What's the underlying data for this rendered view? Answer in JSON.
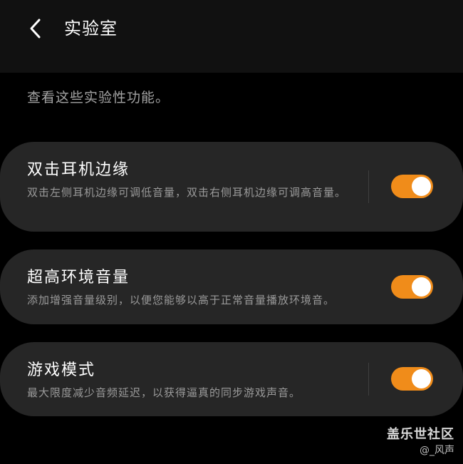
{
  "header": {
    "title": "实验室",
    "back_icon": "chevron-left-icon"
  },
  "description": "查看这些实验性功能。",
  "features": [
    {
      "title": "双击耳机边缘",
      "description": "双击左侧耳机边缘可调低音量，双击右侧耳机边缘可调高音量。",
      "enabled": true
    },
    {
      "title": "超高环境音量",
      "description": "添加增强音量级别，以便您能够以高于正常音量播放环境音。",
      "enabled": true
    },
    {
      "title": "游戏模式",
      "description": "最大限度减少音频延迟，以获得逼真的同步游戏声音。",
      "enabled": true
    }
  ],
  "colors": {
    "accent": "#f08c1a",
    "card": "#262626",
    "background": "#000000"
  },
  "watermark": {
    "site": "盖乐世社区",
    "user": "@_风声"
  }
}
